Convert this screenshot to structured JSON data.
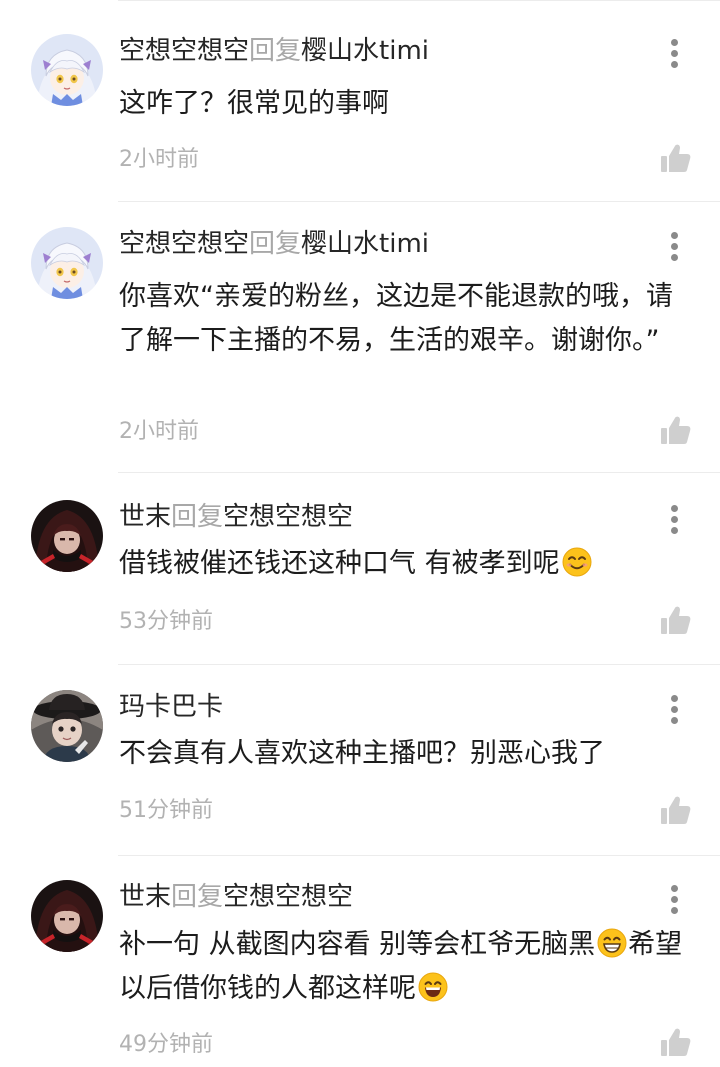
{
  "reply_word": "回复",
  "colors": {
    "name": "#262626",
    "reply_word": "#a8a8a8",
    "time": "#b2b2b2",
    "icon": "#cfcfcf",
    "divider": "#ececec"
  },
  "comments": [
    {
      "author": "空想空想空",
      "reply_to": "樱山水timi",
      "text": "这咋了？很常见的事啊",
      "time": "2小时前",
      "avatar": "anime-girl-avatar"
    },
    {
      "author": "空想空想空",
      "reply_to": "樱山水timi",
      "text": "你喜欢“亲爱的粉丝，这边是不能退款的哦，请了解一下主播的不易，生活的艰辛。谢谢你。”",
      "time": "2小时前",
      "avatar": "anime-girl-avatar"
    },
    {
      "author": "世末",
      "reply_to": "空想空想空",
      "text": "借钱被催还钱还这种口气 有被孝到呢",
      "time": "53分钟前",
      "avatar": "dark-hooded-avatar"
    },
    {
      "author": "玛卡巴卡",
      "reply_to": "",
      "text": "不会真有人喜欢这种主播吧？别恶心我了",
      "time": "51分钟前",
      "avatar": "dark-hat-avatar"
    },
    {
      "author": "世末",
      "reply_to": "空想空想空",
      "text_parts": [
        "补一句 从截图内容看 别等会杠爷无脑黑",
        "希望以后借你钱的人都这样呢"
      ],
      "time": "49分钟前",
      "avatar": "dark-hooded-avatar"
    }
  ]
}
